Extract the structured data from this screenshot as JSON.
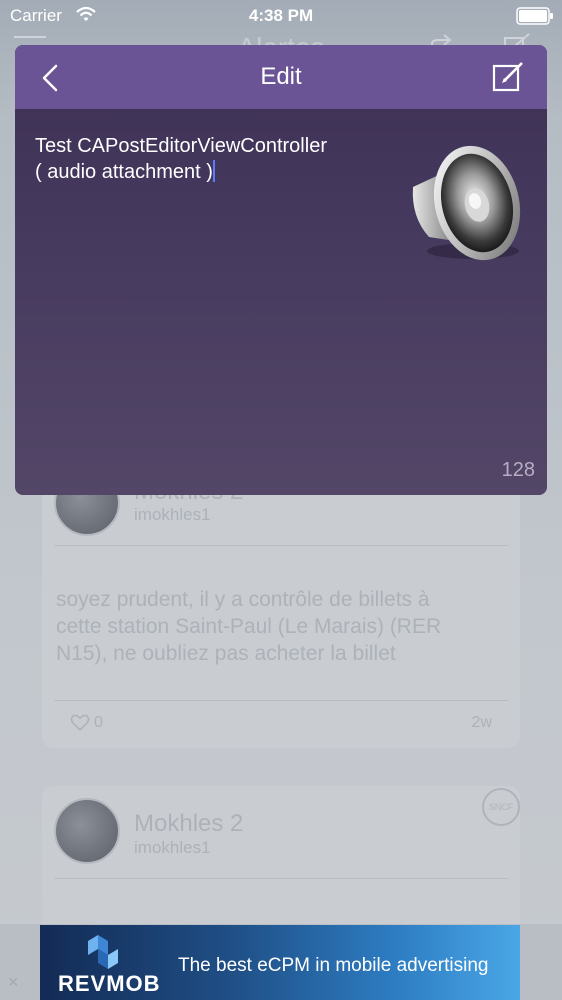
{
  "status_bar": {
    "carrier": "Carrier",
    "time": "4:38 PM"
  },
  "background": {
    "nav_title": "Alertes",
    "posts": [
      {
        "author": "Mokhles 2",
        "handle": "imokhles1",
        "text": "soyez prudent, il y a contrôle de billets à cette station Saint-Paul (Le Marais) (RER N15), ne oubliez pas acheter la billet",
        "likes": "0",
        "age": "2w"
      },
      {
        "author": "Mokhles 2",
        "handle": "imokhles1",
        "badge": "SNCF"
      }
    ]
  },
  "modal": {
    "title": "Edit",
    "post_text": "Test CAPostEditorViewController\n( audio attachment )",
    "char_count": "128",
    "attachment_icon": "speaker-icon",
    "header_color": "#6a5496"
  },
  "ad": {
    "brand": "REVMOB",
    "tagline": "The best eCPM in mobile advertising",
    "close": "×"
  }
}
